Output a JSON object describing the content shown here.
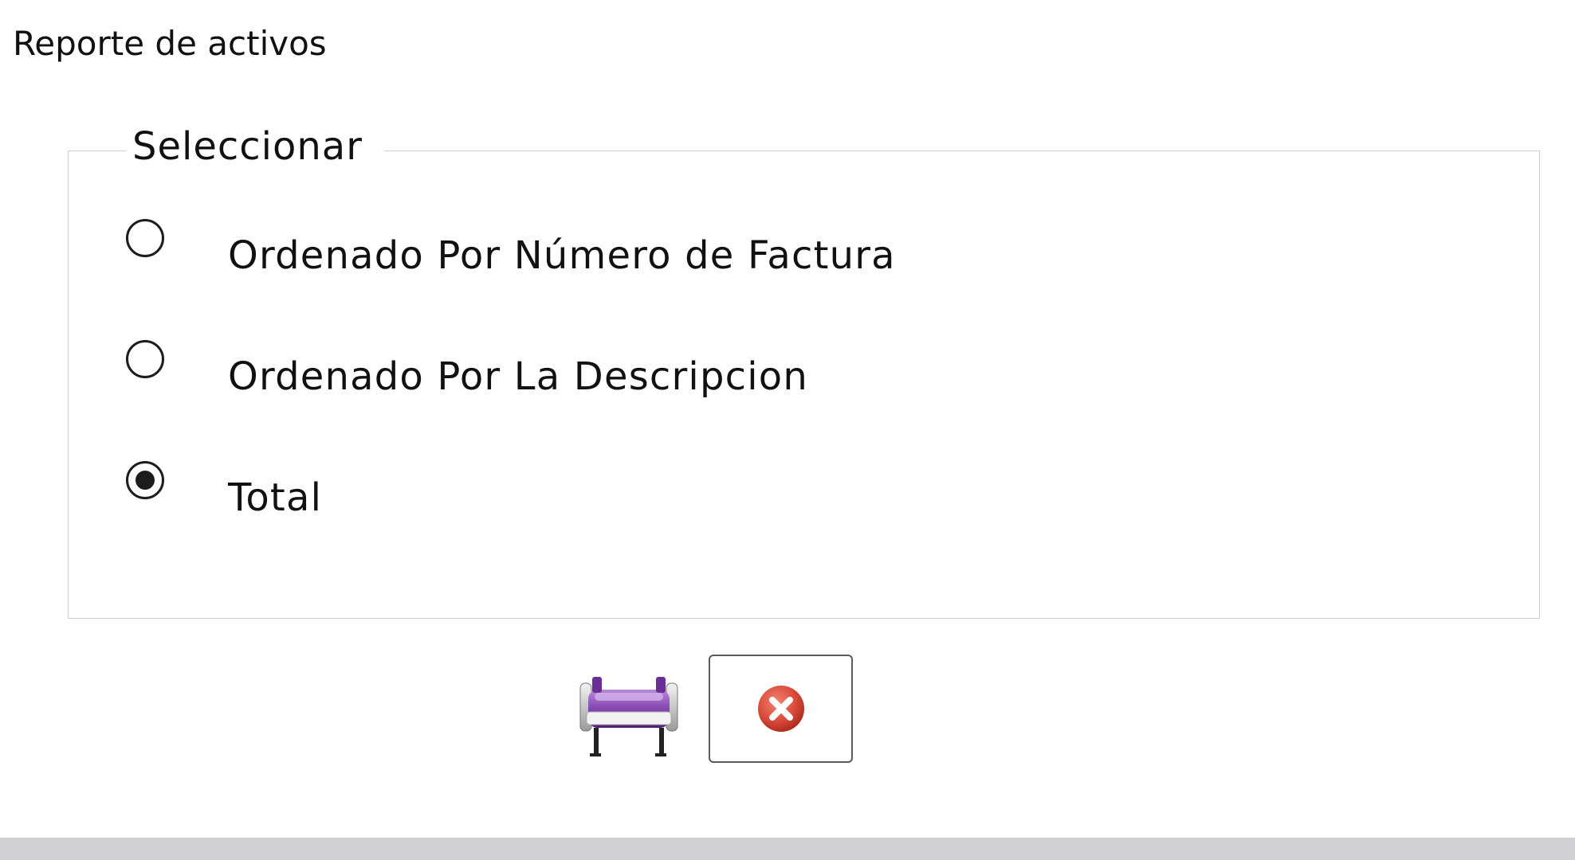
{
  "window": {
    "title": "Reporte de activos"
  },
  "group": {
    "legend": "Seleccionar",
    "options": [
      {
        "label": "Ordenado Por Número de Factura",
        "checked": false
      },
      {
        "label": "Ordenado Por La Descripcion",
        "checked": false
      },
      {
        "label": "Total",
        "checked": true
      }
    ]
  },
  "icons": {
    "print": "printer-icon",
    "cancel": "close-circle-icon"
  },
  "colors": {
    "cancel_red": "#d94a3a",
    "printer_purple": "#7a3fa0"
  }
}
